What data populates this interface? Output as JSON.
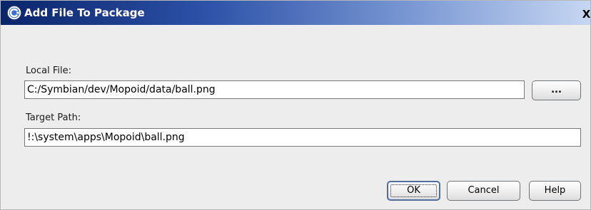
{
  "dialog": {
    "title": "Add File To Package",
    "close_glyph": "X",
    "icon": "carbide-c-icon"
  },
  "local_file": {
    "label": "Local File:",
    "value": "C:/Symbian/dev/Mopoid/data/ball.png",
    "browse_label": "..."
  },
  "target_path": {
    "label": "Target Path:",
    "value": "!:\\system\\apps\\Mopoid\\ball.png"
  },
  "buttons": {
    "ok": "OK",
    "cancel": "Cancel",
    "help": "Help"
  },
  "colors": {
    "titlebar_start": "#0a246a",
    "titlebar_end": "#c7d7f2",
    "dialog_bg": "#ededed"
  }
}
